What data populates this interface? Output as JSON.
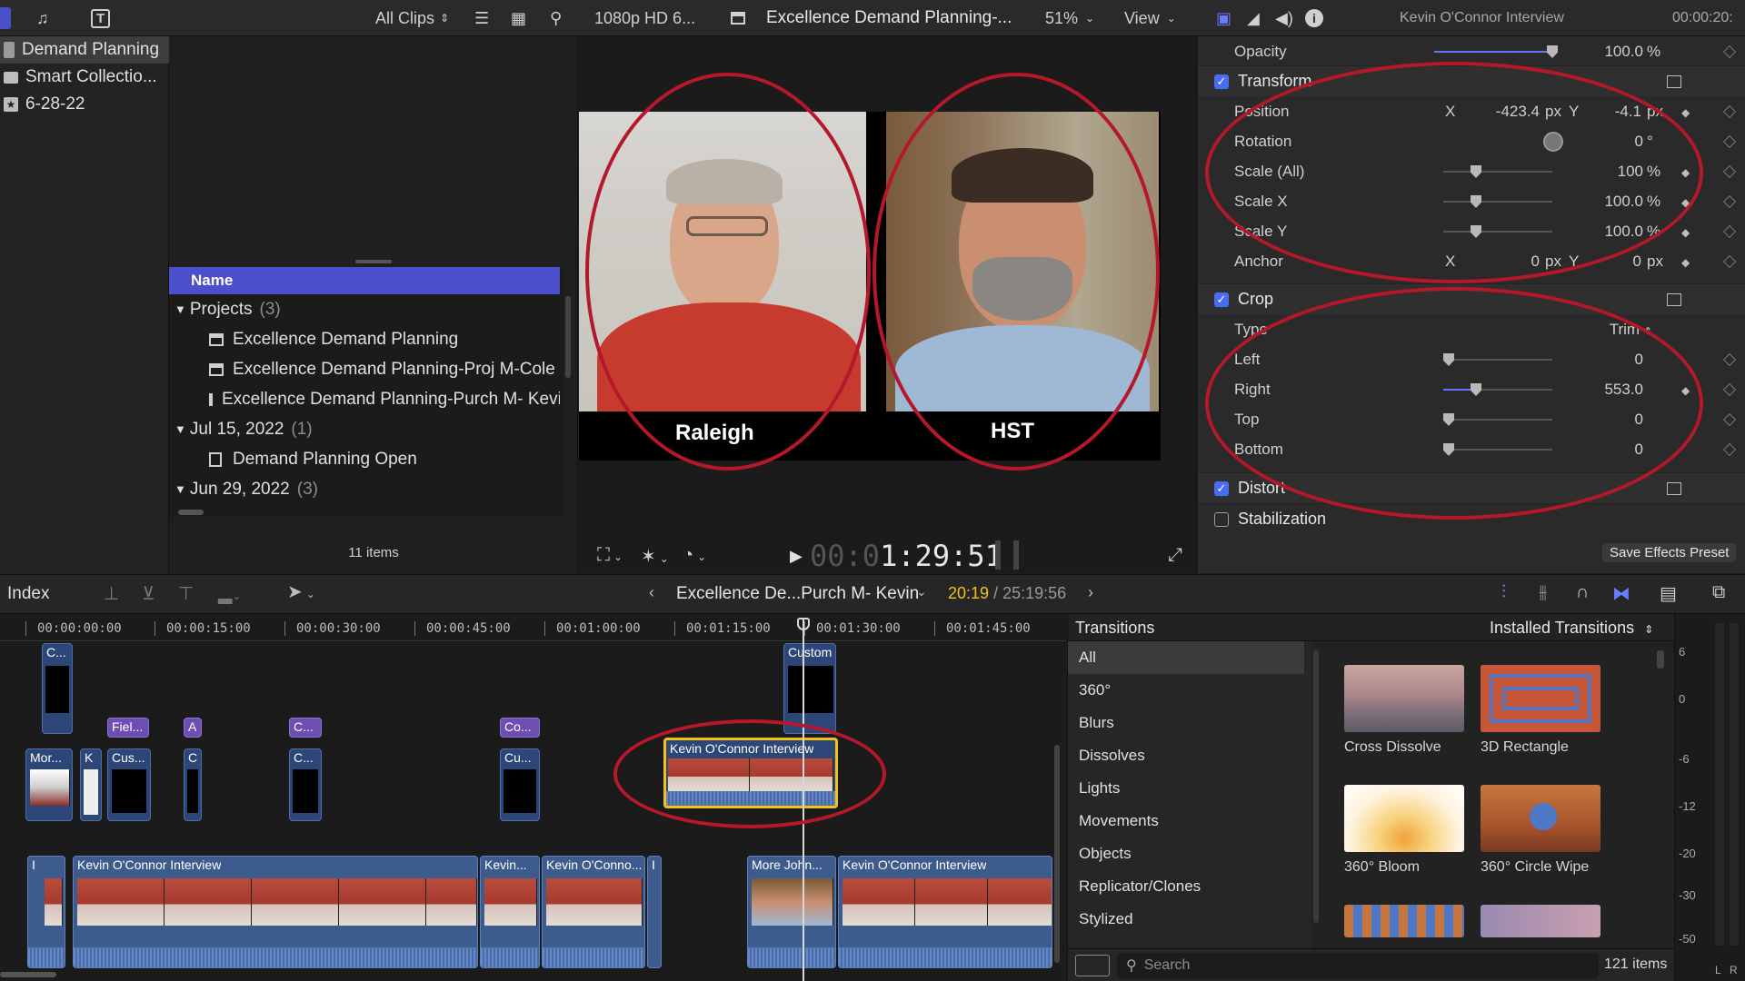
{
  "topbar": {
    "filter_label": "All Clips",
    "format": "1080p HD 6...",
    "project_title": "Excellence Demand Planning-...",
    "zoom": "51%",
    "view_label": "View",
    "inspector_title": "Kevin O'Connor Interview",
    "inspector_time": "00:00:20:"
  },
  "library": {
    "items": [
      {
        "label": "Demand Planning",
        "icon": "library-icon"
      },
      {
        "label": "Smart Collectio...",
        "icon": "folder-icon"
      },
      {
        "label": "6-28-22",
        "icon": "star-icon"
      }
    ]
  },
  "browser": {
    "column_header": "Name",
    "groups": [
      {
        "label": "Projects",
        "count": "(3)",
        "items": [
          "Excellence Demand Planning",
          "Excellence Demand Planning-Proj M-Cole",
          "Excellence Demand Planning-Purch M- Kevin"
        ]
      },
      {
        "label": "Jul 15, 2022",
        "count": "(1)",
        "items": [
          "Demand Planning Open"
        ]
      },
      {
        "label": "Jun 29, 2022",
        "count": "(3)",
        "items": []
      }
    ],
    "item_count": "11 items"
  },
  "viewer": {
    "left_label": "Raleigh",
    "right_label": "HST",
    "timecode_dim": "00:0",
    "timecode": "1:29:51"
  },
  "inspector": {
    "opacity": {
      "name": "Opacity",
      "value": "100.0",
      "unit": "%"
    },
    "transform": {
      "title": "Transform",
      "position": {
        "name": "Position",
        "x": "-423.4",
        "y": "-4.1",
        "unit": "px"
      },
      "rotation": {
        "name": "Rotation",
        "value": "0",
        "unit": "°"
      },
      "scale_all": {
        "name": "Scale (All)",
        "value": "100",
        "unit": "%"
      },
      "scale_x": {
        "name": "Scale X",
        "value": "100.0",
        "unit": "%"
      },
      "scale_y": {
        "name": "Scale Y",
        "value": "100.0",
        "unit": "%"
      },
      "anchor": {
        "name": "Anchor",
        "x": "0",
        "y": "0",
        "unit": "px"
      }
    },
    "crop": {
      "title": "Crop",
      "type_name": "Type",
      "type_value": "Trim",
      "left": {
        "name": "Left",
        "value": "0"
      },
      "right": {
        "name": "Right",
        "value": "553.0"
      },
      "top": {
        "name": "Top",
        "value": "0"
      },
      "bottom": {
        "name": "Bottom",
        "value": "0"
      }
    },
    "distort_title": "Distort",
    "stabilization_title": "Stabilization",
    "save_preset": "Save Effects Preset",
    "axis_x": "X",
    "axis_y": "Y"
  },
  "timeline_toolbar": {
    "index_label": "Index",
    "project_name": "Excellence De...Purch M- Kevin",
    "time_current": "20:19",
    "time_total": "/ 25:19:56"
  },
  "timeline": {
    "ruler": [
      "00:00:00:00",
      "00:00:15:00",
      "00:00:30:00",
      "00:00:45:00",
      "00:01:00:00",
      "00:01:15:00",
      "00:01:30:00",
      "00:01:45:00"
    ],
    "clips": {
      "custom": "Custom",
      "c1": "C...",
      "field": "Fiel...",
      "a": "A",
      "c2": "C...",
      "co": "Co...",
      "mor": "Mor...",
      "k": "K",
      "cus": "Cus...",
      "c3": "C",
      "c4": "C...",
      "cu": "Cu...",
      "selected": "Kevin O'Connor Interview",
      "main1_i": "I",
      "main1": "Kevin O'Connor Interview",
      "main2": "Kevin...",
      "main3": "Kevin O'Conno...",
      "main3_i": "I",
      "more": "More John...",
      "main4": "Kevin O'Connor Interview"
    }
  },
  "transitions": {
    "title": "Transitions",
    "filter": "Installed Transitions",
    "categories": [
      "All",
      "360°",
      "Blurs",
      "Dissolves",
      "Lights",
      "Movements",
      "Objects",
      "Replicator/Clones",
      "Stylized"
    ],
    "items": [
      "Cross Dissolve",
      "3D Rectangle",
      "360° Bloom",
      "360° Circle Wipe"
    ],
    "search_placeholder": "Search",
    "count": "121 items"
  },
  "meter": {
    "ticks": [
      "6",
      "0",
      "-6",
      "-12",
      "-20",
      "-30",
      "-50"
    ],
    "channels": [
      "L",
      "R"
    ]
  },
  "colors": {
    "accent": "#4b4fc9",
    "annotation": "#b5172b",
    "clip_blue": "#3d5b8c",
    "title_purple": "#6c4fb0",
    "selection_yellow": "#f2c21b"
  }
}
